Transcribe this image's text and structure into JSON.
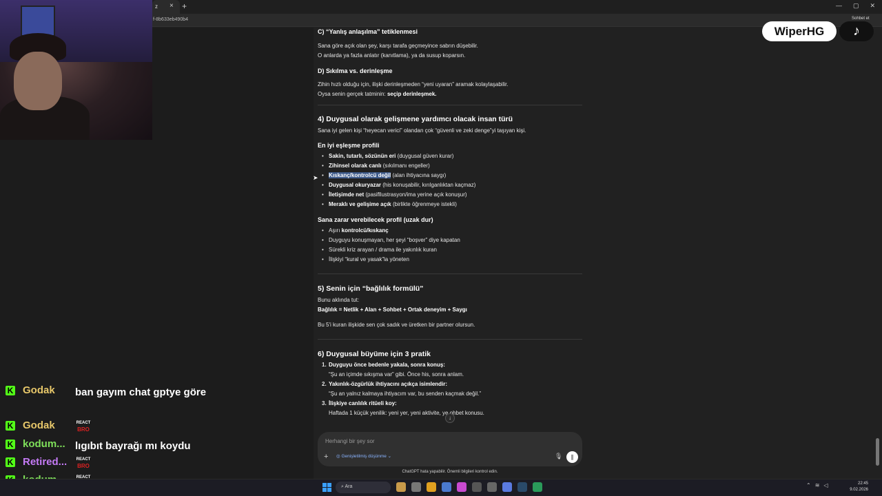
{
  "browser": {
    "tab_close": "×",
    "new_tab": "+",
    "url": "f-8b633eb490b4",
    "share": "Sohbet et",
    "window_controls": [
      "—",
      "▢",
      "✕"
    ]
  },
  "watermark": {
    "name": "WiperHG",
    "tiktok_icon": "♪"
  },
  "content": {
    "c_heading": "C) “Yanlış anlaşılma” tetiklenmesi",
    "c_p1": "Sana göre açık olan şey, karşı tarafa geçmeyince sabrın düşebilir.",
    "c_p2": "O anlarda ya fazla anlatır (kanıtlama), ya da susup koparsın.",
    "d_heading": "D) Sıkılma vs. derinleşme",
    "d_p1": "Zihin hızlı olduğu için, ilişki derinleşmeden “yeni uyaran” aramak kolaylaşabilir.",
    "d_p2_pre": "Oysa senin gerçek tatminin: ",
    "d_p2_bold": "seçip derinleşmek.",
    "s4_heading": "4) Duygusal olarak gelişmene yardımcı olacak insan türü",
    "s4_intro": "Sana iyi gelen kişi “heyecan verici” olandan çok “güvenli ve zeki denge”yi taşıyan kişi.",
    "best_heading": "En iyi eşleşme profili",
    "best_items": [
      {
        "bold": "Sakin, tutarlı, sözünün eri",
        "rest": " (duygusal güven kurar)"
      },
      {
        "bold": "Zihinsel olarak canlı",
        "rest": " (sıkılmanı engeller)"
      },
      {
        "bold": "Kıskanç/kontrolcü değil",
        "rest": " (alan ihtiyacına saygı)"
      },
      {
        "bold": "Duygusal okuryazar",
        "rest": " (his konuşabilir, kırılganlıktan kaçmaz)"
      },
      {
        "bold": "İletişimde net",
        "rest": " (pasifllustrasyon/ima yerine açık konuşur)"
      },
      {
        "bold": "Meraklı ve gelişime açık",
        "rest": " (birlikte öğrenmeye istekli)"
      }
    ],
    "bad_heading": "Sana zarar verebilecek profil (uzak dur)",
    "bad_items": [
      {
        "pre": "Aşırı ",
        "bold": "kontrolcü/kıskanç",
        "rest": ""
      },
      {
        "pre": "Duyguyu konuşmayan, her şeyi “boşver” diye kapatan",
        "bold": "",
        "rest": ""
      },
      {
        "pre": "Sürekli kriz arayan / drama ile yakınlık kuran",
        "bold": "",
        "rest": ""
      },
      {
        "pre": "İlişkiyi “kural ve yasak”la yöneten",
        "bold": "",
        "rest": ""
      }
    ],
    "s5_heading": "5) Senin için “bağlılık formülü”",
    "s5_p1": "Bunu aklında tut:",
    "s5_formula": "Bağlılık = Netlik + Alan + Sohbet + Ortak deneyim + Saygı",
    "s5_p2": "Bu 5'i kuran ilişkide sen çok sadık ve üretken bir partner olursun.",
    "s6_heading": "6) Duygusal büyüme için 3 pratik",
    "practices": [
      {
        "num": "1.",
        "title": "Duyguyu önce bedenle yakala, sonra konuş:",
        "body": "“Şu an içimde sıkışma var” gibi. Önce his, sonra anlam."
      },
      {
        "num": "2.",
        "title": "Yakınlık-özgürlük ihtiyacını açıkça isimlendir:",
        "body": "“Şu an yalnız kalmaya ihtiyacım var, bu senden kaçmak değil.”"
      },
      {
        "num": "3.",
        "title": "İlişkiye canlılık ritüeli koy:",
        "body": "Haftada 1 küçük yenilik: yeni yer, yeni aktivite, ye  ohbet konusu."
      }
    ]
  },
  "composer": {
    "placeholder": "Herhangi bir şey sor",
    "plus": "+",
    "think_label": "◎  Genişletilmiş düşünme  ⌄",
    "mic": "🎙",
    "voice": "∥",
    "scroll_down": "↓"
  },
  "disclaimer": "ChatGPT hata yapabilir. Önemli bilgileri kontrol edin.",
  "chat": [
    {
      "user": "Godak",
      "color": "#e7c76a",
      "text": "ban gayım chat gptye göre",
      "emote": false
    },
    {
      "user": "Godak",
      "color": "#e7c76a",
      "text": "",
      "emote": true
    },
    {
      "user": "kodum...",
      "color": "#7fe05a",
      "text": "lıgıbıt bayrağı mı koydu",
      "emote": false
    },
    {
      "user": "Retired...",
      "color": "#c67bf7",
      "text": "",
      "emote": true
    },
    {
      "user": "kodum...",
      "color": "#7fe05a",
      "text": "",
      "emote": true
    }
  ],
  "emote": {
    "top": "REACT",
    "bottom": "BRO"
  },
  "taskbar": {
    "search": "Ara",
    "time": "22:45",
    "date": "9.02.2026"
  }
}
